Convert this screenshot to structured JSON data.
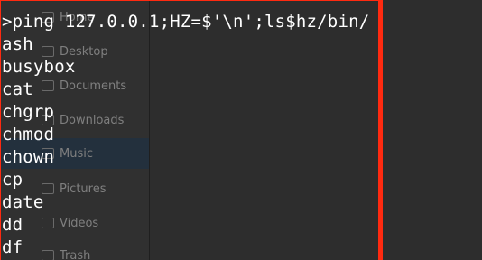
{
  "sidebar": {
    "items": [
      {
        "label": "Home",
        "icon": "home-icon"
      },
      {
        "label": "Desktop",
        "icon": "folder-icon"
      },
      {
        "label": "Documents",
        "icon": "folder-icon"
      },
      {
        "label": "Downloads",
        "icon": "download-icon"
      },
      {
        "label": "Music",
        "icon": "music-icon"
      },
      {
        "label": "Pictures",
        "icon": "folder-icon"
      },
      {
        "label": "Videos",
        "icon": "video-icon"
      },
      {
        "label": "Trash",
        "icon": "trash-icon"
      }
    ]
  },
  "terminal": {
    "command": ">ping 127.0.0.1;HZ=$'\\n';ls$hz/bin/",
    "output": [
      "ash",
      "busybox",
      "cat",
      "chgrp",
      "chmod",
      "chown",
      "cp",
      "date",
      "dd",
      "df"
    ]
  },
  "colors": {
    "frame": "#ff2a10",
    "text": "#ffffff",
    "background": "#2b2b2b"
  }
}
